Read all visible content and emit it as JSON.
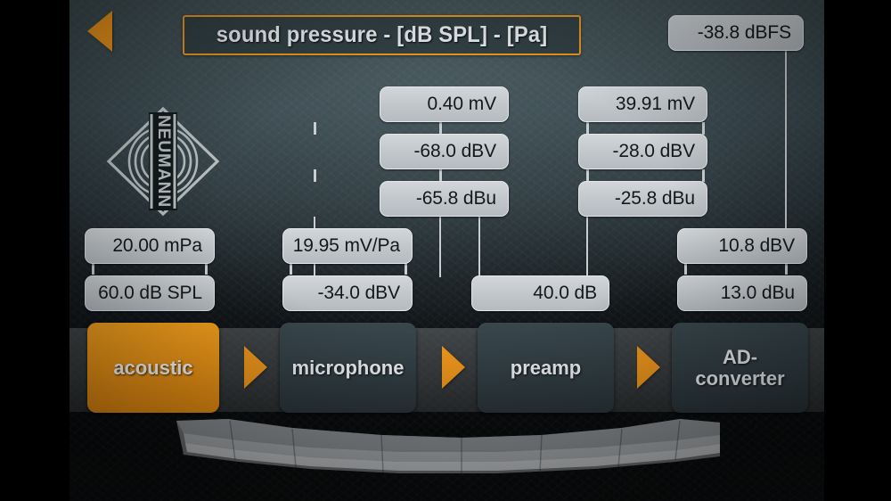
{
  "app": {
    "title": "sound pressure - [dB SPL] - [Pa]",
    "accent_color": "#f0971c",
    "panel_color": "#323f45",
    "pill_color": "#c3c8cc"
  },
  "header": {
    "back_icon": "back-arrow-icon",
    "title": "sound pressure - [dB SPL] - [Pa]"
  },
  "logo": {
    "name": "neumann-logo",
    "text": "NEUMANN"
  },
  "chain": {
    "stages": [
      {
        "id": "acoustic",
        "label": "acoustic",
        "active": true
      },
      {
        "id": "microphone",
        "label": "microphone",
        "active": false
      },
      {
        "id": "preamp",
        "label": "preamp",
        "active": false
      },
      {
        "id": "ad-converter",
        "label_line1": "AD-",
        "label_line2": "converter",
        "active": false
      }
    ],
    "separator_icon": "chevron-right-icon"
  },
  "values": {
    "acoustic": {
      "pressure_pa": "20.00 mPa",
      "pressure_spl": "60.0 dB SPL"
    },
    "microphone": {
      "sensitivity_mv_per_pa": "19.95 mV/Pa",
      "sensitivity_dbv": "-34.0 dBV"
    },
    "mic_output": {
      "level_mv": "0.40 mV",
      "level_dbv": "-68.0 dBV",
      "level_dbu": "-65.8 dBu"
    },
    "preamp": {
      "gain_db": "40.0 dB"
    },
    "preamp_output": {
      "level_mv": "39.91 mV",
      "level_dbv": "-28.0 dBV",
      "level_dbu": "-25.8 dBu"
    },
    "ad_converter": {
      "full_scale_dbv": "10.8 dBV",
      "full_scale_dbu": "13.0 dBu"
    },
    "output": {
      "level_dbfs": "-38.8 dBFS"
    }
  }
}
